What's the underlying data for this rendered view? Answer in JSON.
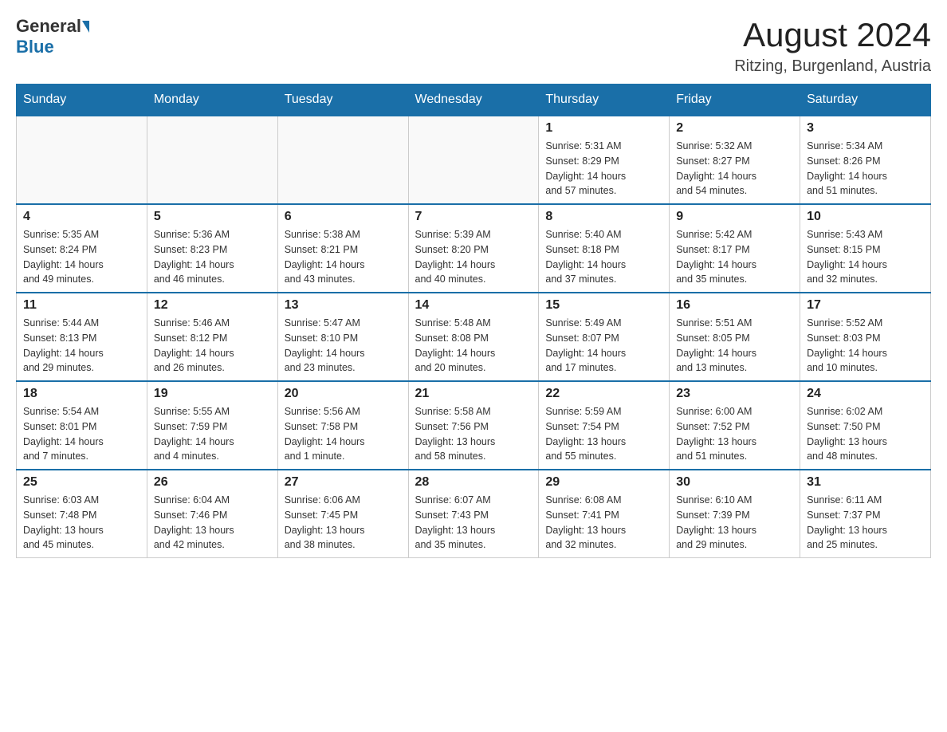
{
  "header": {
    "logo_general": "General",
    "logo_blue": "Blue",
    "month_year": "August 2024",
    "location": "Ritzing, Burgenland, Austria"
  },
  "weekdays": [
    "Sunday",
    "Monday",
    "Tuesday",
    "Wednesday",
    "Thursday",
    "Friday",
    "Saturday"
  ],
  "weeks": [
    [
      {
        "day": "",
        "info": ""
      },
      {
        "day": "",
        "info": ""
      },
      {
        "day": "",
        "info": ""
      },
      {
        "day": "",
        "info": ""
      },
      {
        "day": "1",
        "info": "Sunrise: 5:31 AM\nSunset: 8:29 PM\nDaylight: 14 hours\nand 57 minutes."
      },
      {
        "day": "2",
        "info": "Sunrise: 5:32 AM\nSunset: 8:27 PM\nDaylight: 14 hours\nand 54 minutes."
      },
      {
        "day": "3",
        "info": "Sunrise: 5:34 AM\nSunset: 8:26 PM\nDaylight: 14 hours\nand 51 minutes."
      }
    ],
    [
      {
        "day": "4",
        "info": "Sunrise: 5:35 AM\nSunset: 8:24 PM\nDaylight: 14 hours\nand 49 minutes."
      },
      {
        "day": "5",
        "info": "Sunrise: 5:36 AM\nSunset: 8:23 PM\nDaylight: 14 hours\nand 46 minutes."
      },
      {
        "day": "6",
        "info": "Sunrise: 5:38 AM\nSunset: 8:21 PM\nDaylight: 14 hours\nand 43 minutes."
      },
      {
        "day": "7",
        "info": "Sunrise: 5:39 AM\nSunset: 8:20 PM\nDaylight: 14 hours\nand 40 minutes."
      },
      {
        "day": "8",
        "info": "Sunrise: 5:40 AM\nSunset: 8:18 PM\nDaylight: 14 hours\nand 37 minutes."
      },
      {
        "day": "9",
        "info": "Sunrise: 5:42 AM\nSunset: 8:17 PM\nDaylight: 14 hours\nand 35 minutes."
      },
      {
        "day": "10",
        "info": "Sunrise: 5:43 AM\nSunset: 8:15 PM\nDaylight: 14 hours\nand 32 minutes."
      }
    ],
    [
      {
        "day": "11",
        "info": "Sunrise: 5:44 AM\nSunset: 8:13 PM\nDaylight: 14 hours\nand 29 minutes."
      },
      {
        "day": "12",
        "info": "Sunrise: 5:46 AM\nSunset: 8:12 PM\nDaylight: 14 hours\nand 26 minutes."
      },
      {
        "day": "13",
        "info": "Sunrise: 5:47 AM\nSunset: 8:10 PM\nDaylight: 14 hours\nand 23 minutes."
      },
      {
        "day": "14",
        "info": "Sunrise: 5:48 AM\nSunset: 8:08 PM\nDaylight: 14 hours\nand 20 minutes."
      },
      {
        "day": "15",
        "info": "Sunrise: 5:49 AM\nSunset: 8:07 PM\nDaylight: 14 hours\nand 17 minutes."
      },
      {
        "day": "16",
        "info": "Sunrise: 5:51 AM\nSunset: 8:05 PM\nDaylight: 14 hours\nand 13 minutes."
      },
      {
        "day": "17",
        "info": "Sunrise: 5:52 AM\nSunset: 8:03 PM\nDaylight: 14 hours\nand 10 minutes."
      }
    ],
    [
      {
        "day": "18",
        "info": "Sunrise: 5:54 AM\nSunset: 8:01 PM\nDaylight: 14 hours\nand 7 minutes."
      },
      {
        "day": "19",
        "info": "Sunrise: 5:55 AM\nSunset: 7:59 PM\nDaylight: 14 hours\nand 4 minutes."
      },
      {
        "day": "20",
        "info": "Sunrise: 5:56 AM\nSunset: 7:58 PM\nDaylight: 14 hours\nand 1 minute."
      },
      {
        "day": "21",
        "info": "Sunrise: 5:58 AM\nSunset: 7:56 PM\nDaylight: 13 hours\nand 58 minutes."
      },
      {
        "day": "22",
        "info": "Sunrise: 5:59 AM\nSunset: 7:54 PM\nDaylight: 13 hours\nand 55 minutes."
      },
      {
        "day": "23",
        "info": "Sunrise: 6:00 AM\nSunset: 7:52 PM\nDaylight: 13 hours\nand 51 minutes."
      },
      {
        "day": "24",
        "info": "Sunrise: 6:02 AM\nSunset: 7:50 PM\nDaylight: 13 hours\nand 48 minutes."
      }
    ],
    [
      {
        "day": "25",
        "info": "Sunrise: 6:03 AM\nSunset: 7:48 PM\nDaylight: 13 hours\nand 45 minutes."
      },
      {
        "day": "26",
        "info": "Sunrise: 6:04 AM\nSunset: 7:46 PM\nDaylight: 13 hours\nand 42 minutes."
      },
      {
        "day": "27",
        "info": "Sunrise: 6:06 AM\nSunset: 7:45 PM\nDaylight: 13 hours\nand 38 minutes."
      },
      {
        "day": "28",
        "info": "Sunrise: 6:07 AM\nSunset: 7:43 PM\nDaylight: 13 hours\nand 35 minutes."
      },
      {
        "day": "29",
        "info": "Sunrise: 6:08 AM\nSunset: 7:41 PM\nDaylight: 13 hours\nand 32 minutes."
      },
      {
        "day": "30",
        "info": "Sunrise: 6:10 AM\nSunset: 7:39 PM\nDaylight: 13 hours\nand 29 minutes."
      },
      {
        "day": "31",
        "info": "Sunrise: 6:11 AM\nSunset: 7:37 PM\nDaylight: 13 hours\nand 25 minutes."
      }
    ]
  ]
}
